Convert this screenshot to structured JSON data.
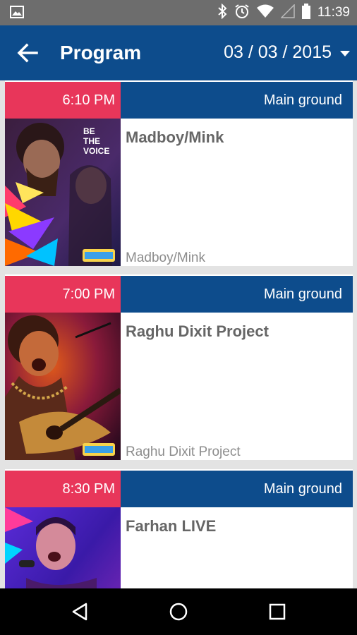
{
  "status_bar": {
    "time": "11:39"
  },
  "app_bar": {
    "title": "Program",
    "date": "03 / 03 / 2015"
  },
  "events": [
    {
      "time": "6:10 PM",
      "venue": "Main ground",
      "title": "Madboy/Mink",
      "subtitle": "Madboy/Mink",
      "poster_text": [
        "BE",
        "THE",
        "VOICE"
      ]
    },
    {
      "time": "7:00 PM",
      "venue": "Main ground",
      "title": "Raghu Dixit Project",
      "subtitle": "Raghu Dixit Project"
    },
    {
      "time": "8:30 PM",
      "venue": "Main ground",
      "title": "Farhan LIVE",
      "subtitle": ""
    }
  ],
  "colors": {
    "primary": "#0d4c8c",
    "accent": "#e8365a",
    "status_bar": "#6d6d6d",
    "background": "#e3e3e3"
  }
}
